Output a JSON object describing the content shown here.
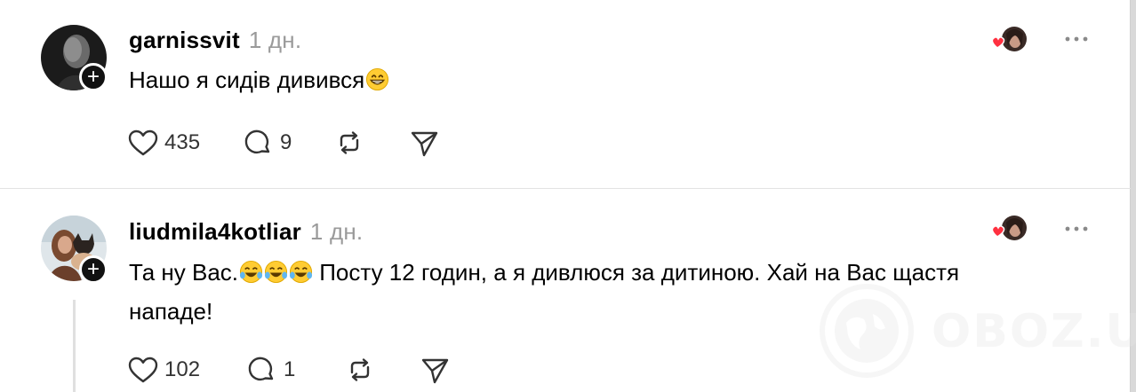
{
  "posts": [
    {
      "username": "garnissvit",
      "time": "1 дн.",
      "text": "Нашо я сидів дивився",
      "text_emojis": [
        "grinning-face"
      ],
      "likes": "435",
      "replies": "9"
    },
    {
      "username": "liudmila4kotliar",
      "time": "1 дн.",
      "text_prefix": "Та ну Вас.",
      "text_emojis": [
        "tears-of-joy",
        "tears-of-joy",
        "tears-of-joy"
      ],
      "text_rest": " Посту 12 годин, а я дивлюся за дитиною. Хай на Вас щастя нападе!",
      "likes": "102",
      "replies": "1"
    }
  ],
  "watermark": {
    "text": "OBOZ.UA"
  },
  "colors": {
    "heart": "#ff3040",
    "time": "#9a9a9a",
    "divider": "#e3e3e3"
  },
  "icons": [
    "like-icon",
    "reply-icon",
    "repost-icon",
    "share-icon",
    "more-icon",
    "follow-plus-icon"
  ]
}
